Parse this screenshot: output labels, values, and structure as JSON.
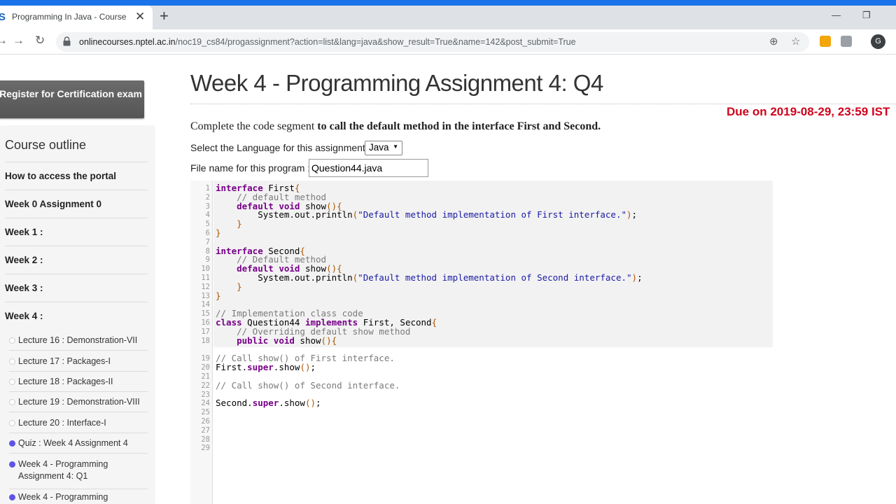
{
  "browser": {
    "tab_title": "Programming In Java - Course",
    "tab_close": "✕",
    "new_tab": "+",
    "url_domain": "onlinecourses.nptel.ac.in",
    "url_path": "/noc19_cs84/progassignment?action=list&lang=java&show_result=True&name=142&post_submit=True",
    "avatar_letter": "G"
  },
  "sidebar": {
    "register_button": "Register for Certification exam",
    "outline_heading": "Course outline",
    "items": [
      "How to access the portal",
      "Week 0 Assignment 0",
      "Week 1 :",
      "Week 2 :",
      "Week 3 :",
      "Week 4 :"
    ],
    "lectures": [
      {
        "label": "Lecture 16 : Demonstration-VII",
        "done": false
      },
      {
        "label": "Lecture 17 : Packages-I",
        "done": false
      },
      {
        "label": "Lecture 18 : Packages-II",
        "done": false
      },
      {
        "label": "Lecture 19 : Demonstration-VIII",
        "done": false
      },
      {
        "label": "Lecture 20 : Interface-I",
        "done": false
      },
      {
        "label": "Quiz : Week 4 Assignment 4",
        "done": true
      },
      {
        "label": "Week 4 - Programming Assignment 4: Q1",
        "done": true
      },
      {
        "label": "Week 4 - Programming",
        "done": true
      }
    ]
  },
  "main": {
    "title": "Week 4 - Programming Assignment 4: Q4",
    "due": "Due on 2019-08-29, 23:59 IST",
    "desc_plain": "Complete the code segment ",
    "desc_bold": "to call the default method in the interface First and Second.",
    "lang_label": "Select the Language for this assignment.",
    "lang_value": "Java",
    "file_label": "File name for this program :",
    "file_value": "Question44.java"
  },
  "editor": {
    "line_numbers": [
      "1",
      "2",
      "3",
      "4",
      "5",
      "6",
      "7",
      "8",
      "9",
      "10",
      "11",
      "12",
      "13",
      "14",
      "15",
      "16",
      "17",
      "18",
      "19",
      "20",
      "21",
      "22",
      "23",
      "24",
      "25",
      "26",
      "27",
      "28",
      "29"
    ],
    "code_lines": [
      "interface First{",
      "    // default method",
      "    default void show(){",
      "        System.out.println(\"Default method implementation of First interface.\");",
      "    }",
      "}",
      "",
      "interface Second{",
      "    // Default method",
      "    default void show(){",
      "        System.out.println(\"Default method implementation of Second interface.\");",
      "    }",
      "}",
      "",
      "// Implementation class code",
      "class Question44 implements First, Second{",
      "    // Overriding default show method",
      "    public void show(){",
      "// Call show() of First interface.",
      "First.super.show();",
      "",
      "// Call show() of Second interface.",
      "",
      "Second.super.show();",
      "",
      "",
      "",
      "",
      ""
    ]
  }
}
